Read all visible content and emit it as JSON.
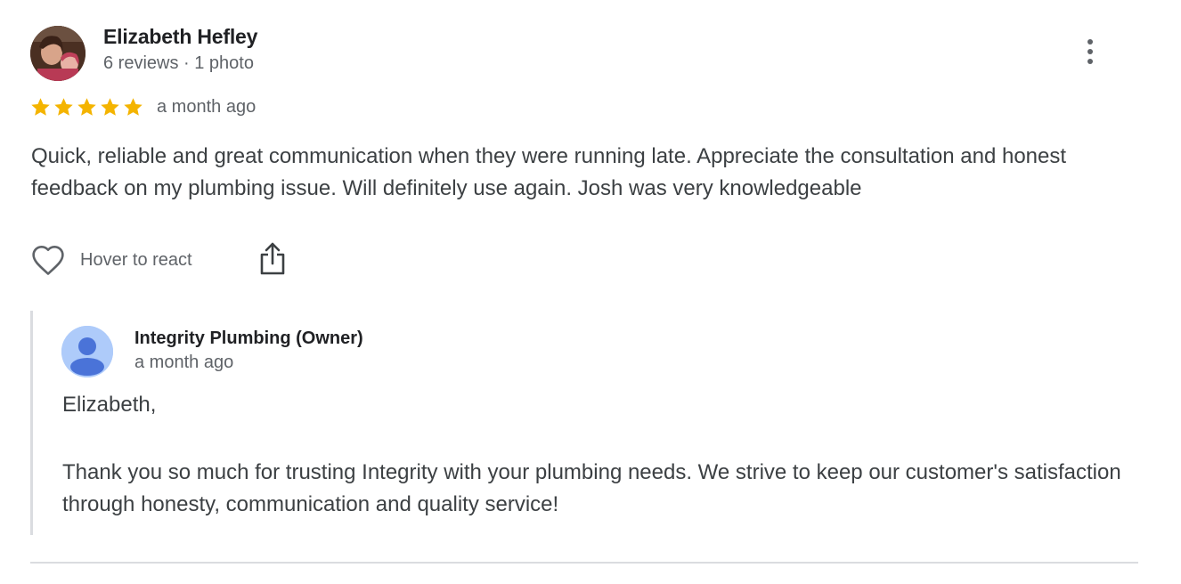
{
  "review": {
    "reviewer_name": "Elizabeth Hefley",
    "reviewer_meta": "6 reviews · 1 photo",
    "rating": 5,
    "date": "a month ago",
    "text": "Quick, reliable and great communication when they were running late. Appreciate the consultation and honest feedback on my plumbing issue. Will definitely use again. Josh was very knowledgeable",
    "react_label": "Hover to react"
  },
  "owner_reply": {
    "name": "Integrity Plumbing (Owner)",
    "date": "a month ago",
    "greeting": "Elizabeth,",
    "body": "Thank you so much for trusting Integrity with your plumbing needs. We strive to keep our customer's satisfaction through honesty, communication and quality service!"
  },
  "icons": {
    "more": "more-vert-icon",
    "star": "star-icon",
    "heart": "heart-outline-icon",
    "share": "share-icon",
    "owner_avatar": "person-icon"
  },
  "colors": {
    "star": "#f4b400",
    "owner_avatar_bg": "#aecbfa",
    "owner_avatar_fg": "#4a73d8",
    "divider": "#dadce0",
    "secondary_text": "#5f6368",
    "primary_text": "#3c4043"
  }
}
